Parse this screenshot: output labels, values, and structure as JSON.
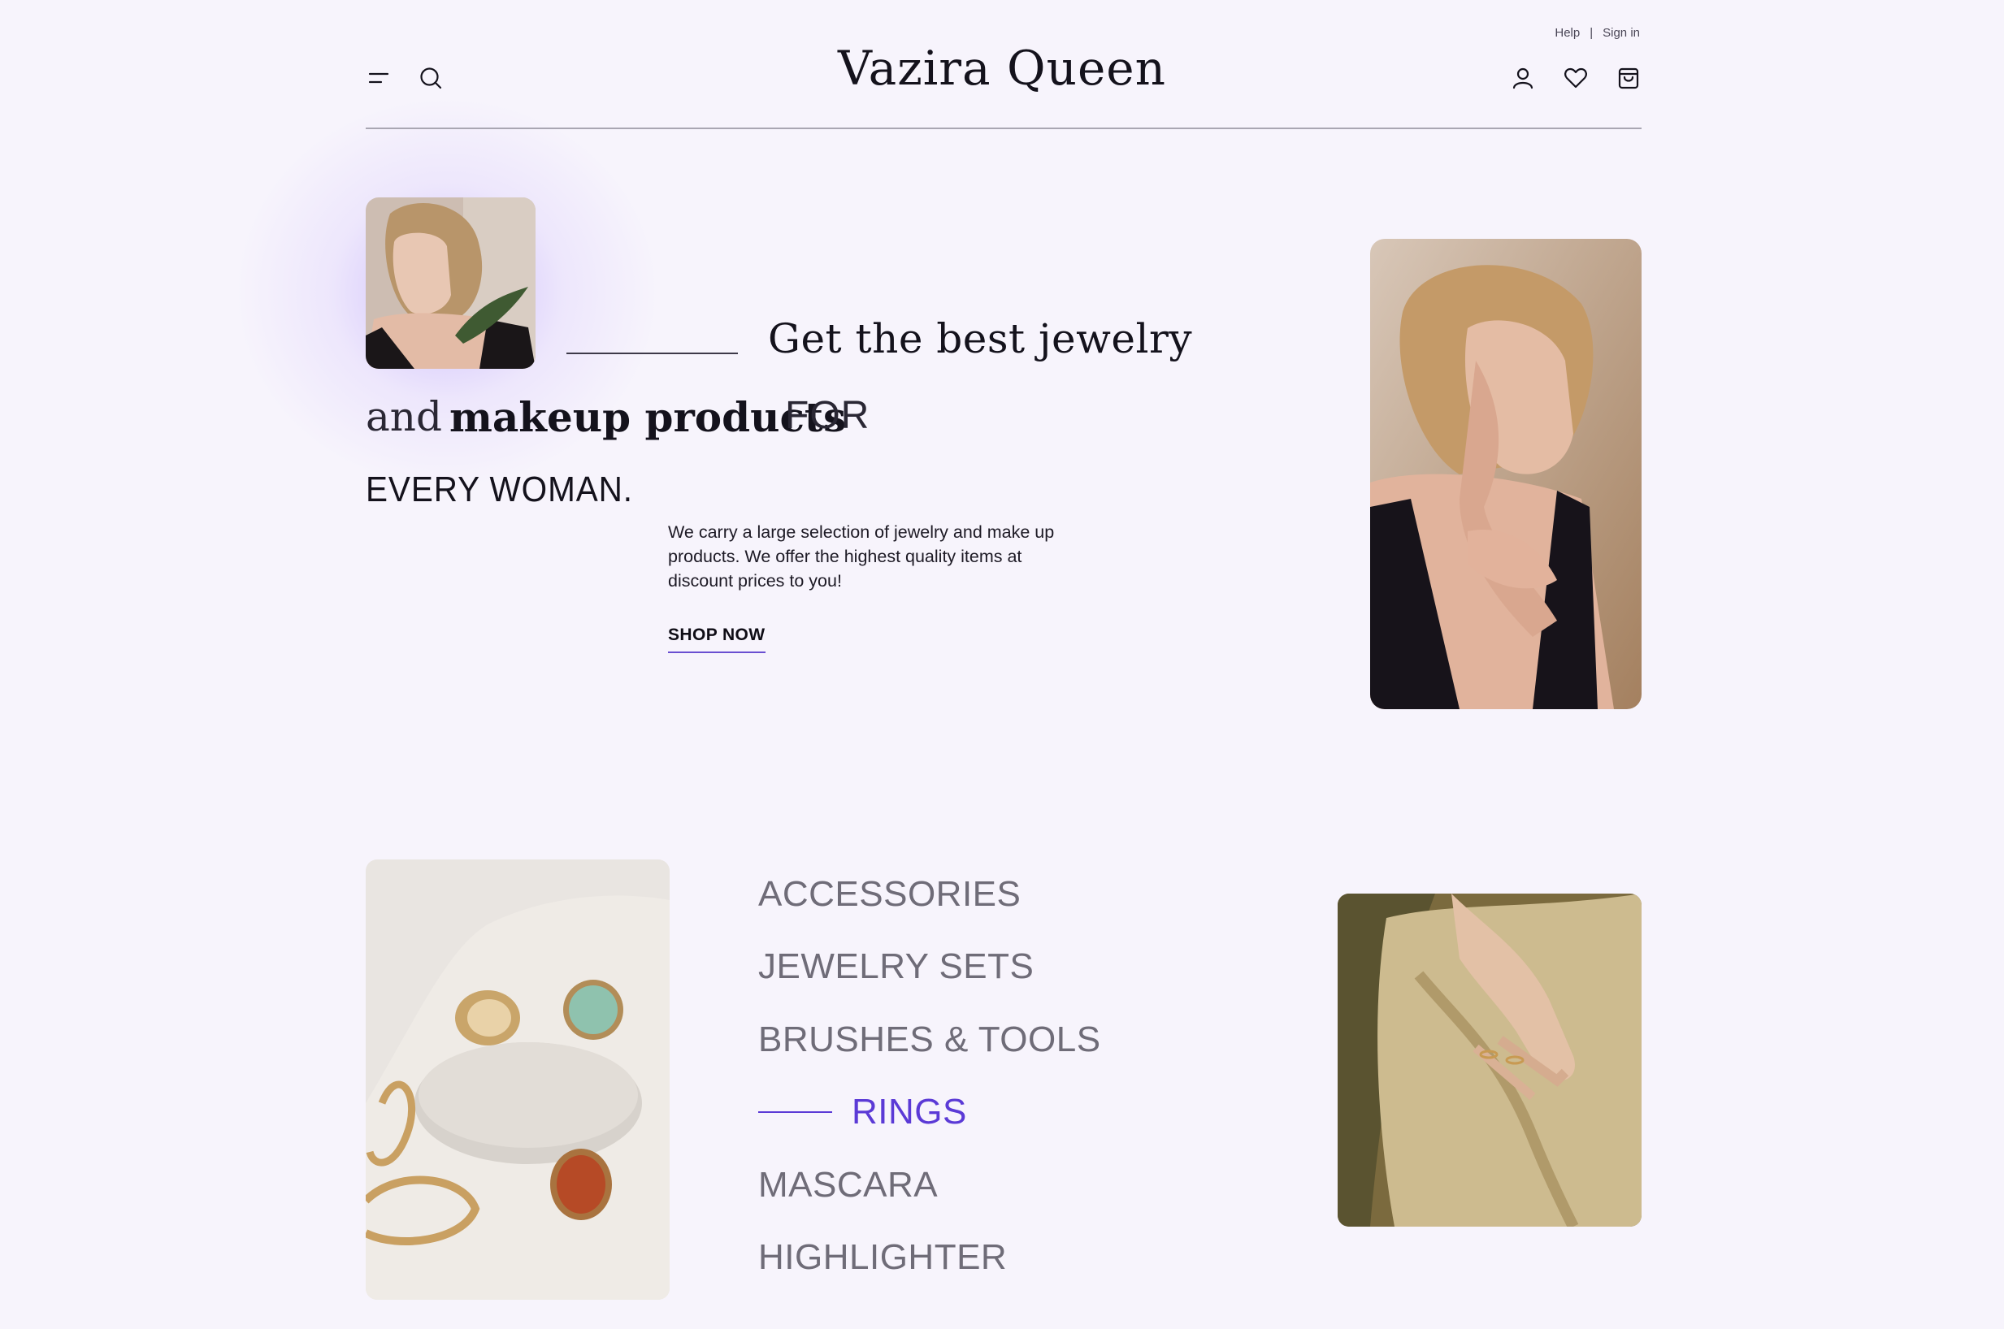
{
  "header": {
    "brand": "Vazira Queen",
    "help_link": "Help",
    "separator": "|",
    "signin_link": "Sign in",
    "icons": {
      "menu": "menu-icon",
      "search": "search-icon",
      "account": "user-icon",
      "wishlist": "heart-icon",
      "cart": "shopping-bag-icon"
    }
  },
  "hero": {
    "headline_line1": "Get the best jewelry",
    "headline_and": "and",
    "headline_makeup": "makeup products",
    "headline_for": "FOR",
    "headline_line3": "EVERY WOMAN.",
    "description": "We carry a large selection of jewelry and make up products. We offer the highest quality items at discount prices to you!",
    "cta_label": "SHOP NOW"
  },
  "categories": {
    "items": [
      {
        "label": "ACCESSORIES",
        "active": false
      },
      {
        "label": "JEWELRY SETS",
        "active": false
      },
      {
        "label": "BRUSHES & TOOLS",
        "active": false
      },
      {
        "label": "RINGS",
        "active": true
      },
      {
        "label": "MASCARA",
        "active": false
      },
      {
        "label": "HIGHLIGHTER",
        "active": false
      }
    ]
  },
  "colors": {
    "background": "#f7f4fc",
    "accent": "#5b3ad6",
    "text": "#14121c",
    "muted_category": "#6f6c78",
    "glow": "#c4b2fa"
  }
}
